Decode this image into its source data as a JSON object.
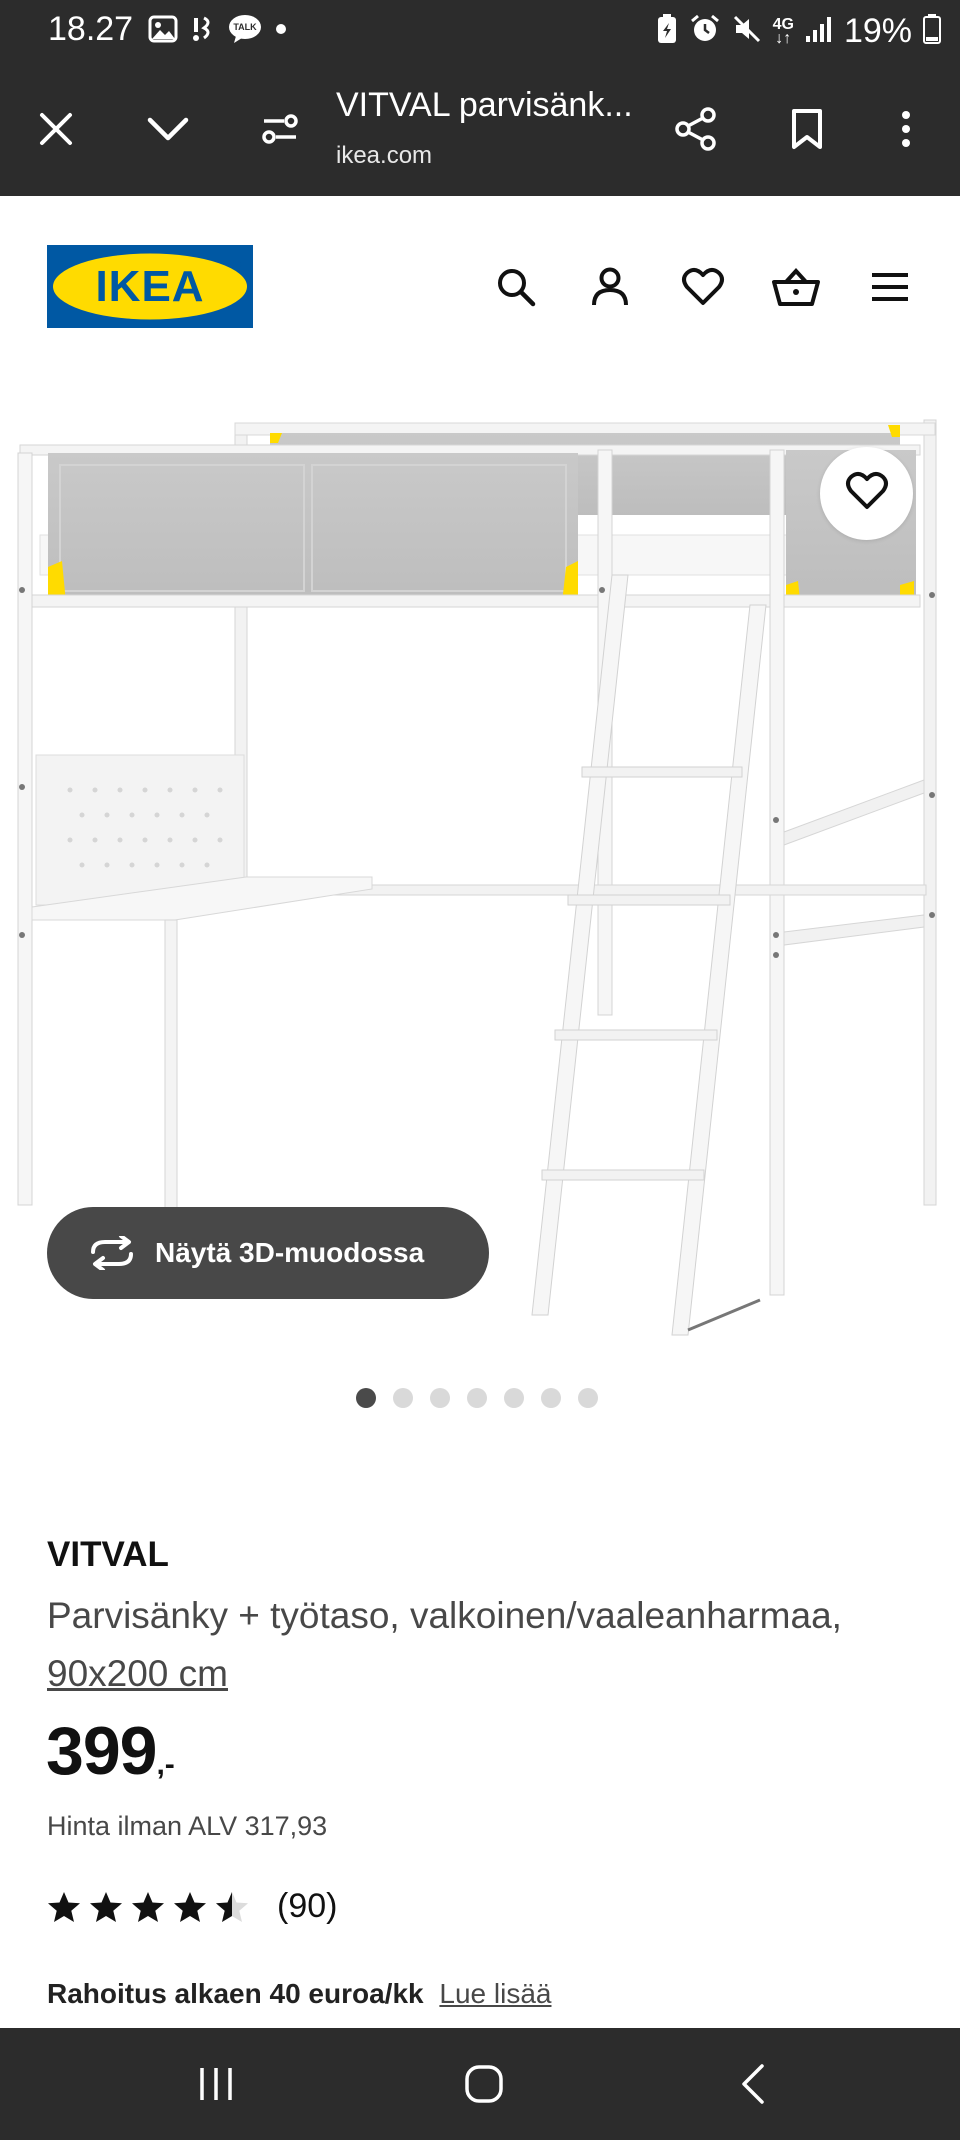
{
  "status_bar": {
    "time": "18.27",
    "network": "4G",
    "battery": "19%",
    "icons": [
      "gallery-icon",
      "notification-icon",
      "talk-icon",
      "dot-icon",
      "battery-saver-icon",
      "alarm-icon",
      "mute-icon",
      "signal-icon",
      "battery-icon"
    ]
  },
  "browser": {
    "title": "VITVAL parvisänk...",
    "url": "ikea.com",
    "icons": [
      "close-icon",
      "chevron-down-icon",
      "page-settings-icon",
      "share-icon",
      "bookmark-icon",
      "more-icon"
    ]
  },
  "header": {
    "logo_text": "IKEA",
    "icons": [
      "search-icon",
      "account-icon",
      "favorites-icon",
      "cart-icon",
      "menu-icon"
    ]
  },
  "gallery": {
    "view_3d_label": "Näytä 3D-muodossa",
    "image_count": 7,
    "active_index": 0
  },
  "product": {
    "name": "VITVAL",
    "description": "Parvisänky + työtaso, valkoinen/vaaleanharmaa,",
    "size": "90x200 cm",
    "price": "399",
    "price_suffix": ",-",
    "vat_text": "Hinta ilman ALV 317,93",
    "rating": 4.5,
    "rating_max": 5,
    "review_count": "(90)",
    "financing_text": "Rahoitus alkaen 40 euroa/kk",
    "financing_link": "Lue lisää"
  },
  "colors": {
    "ikea_blue": "#0058a3",
    "ikea_yellow": "#ffdb00",
    "dark_bar": "#2c2c2c",
    "button_dark": "#484848"
  }
}
